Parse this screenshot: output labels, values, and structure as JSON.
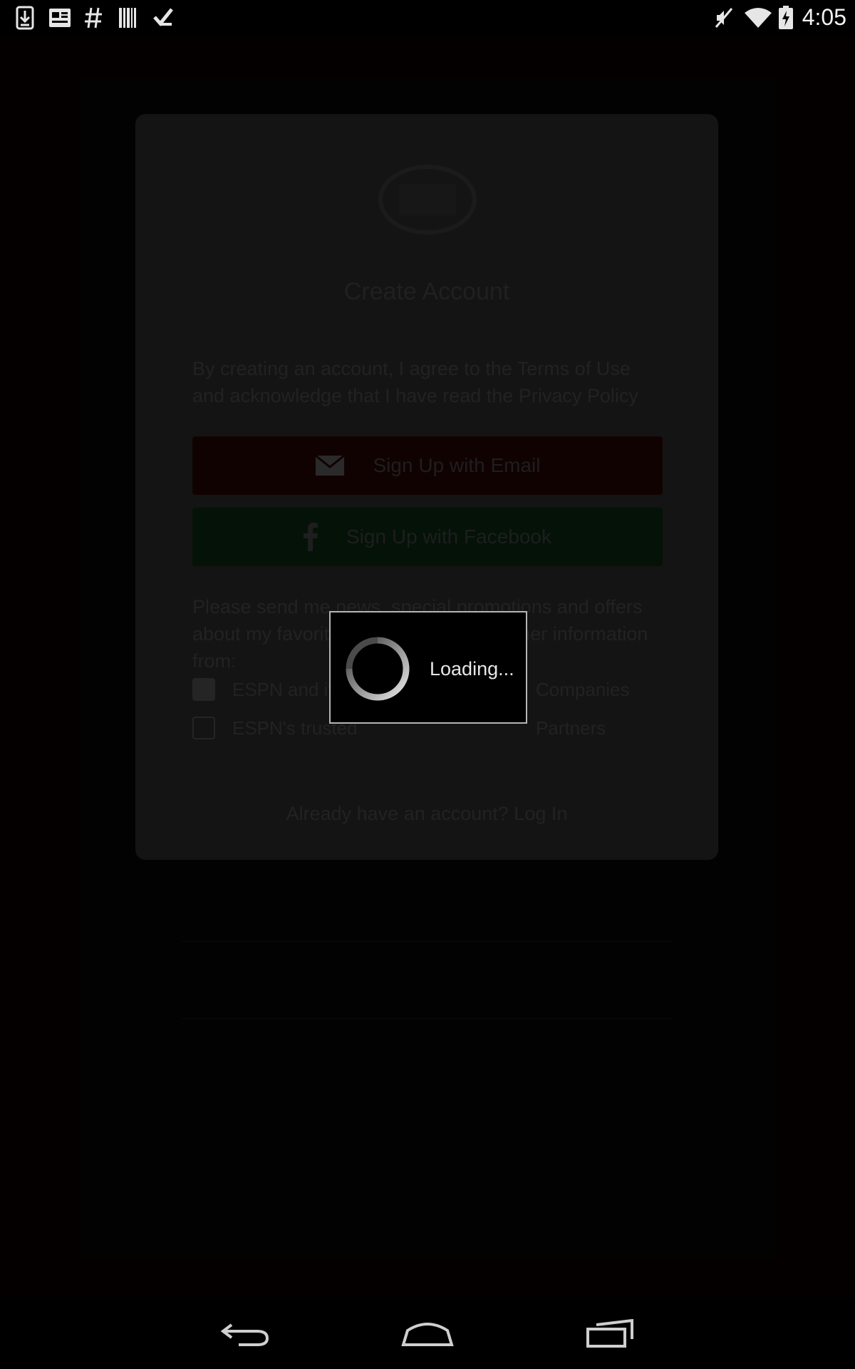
{
  "status_bar": {
    "time": "4:05",
    "left_icons": [
      "download-icon",
      "news-icon",
      "hashtag-icon",
      "barcode-icon",
      "checkmark-icon"
    ],
    "right_icons": [
      "mute-icon",
      "wifi-icon",
      "battery-charging-icon"
    ]
  },
  "card": {
    "title": "Create Account",
    "terms_text": "By creating an account, I agree to the Terms of Use and acknowledge that I have read the Privacy Policy",
    "email_button": "Sign Up with Email",
    "facebook_button": "Sign Up with Facebook",
    "newsletter_text": "Please send me news, special promotions and offers about my favorite teams, sports and other information from:",
    "checkboxes": [
      {
        "start": "ESPN and its",
        "end": "Companies",
        "checked": true
      },
      {
        "start": "ESPN's trusted",
        "end": "Partners",
        "checked": false
      }
    ],
    "login_link": "Already have an account? Log In"
  },
  "dialog": {
    "loading_text": "Loading..."
  },
  "nav": {
    "back": "back-icon",
    "home": "home-icon",
    "recents": "recents-icon"
  }
}
